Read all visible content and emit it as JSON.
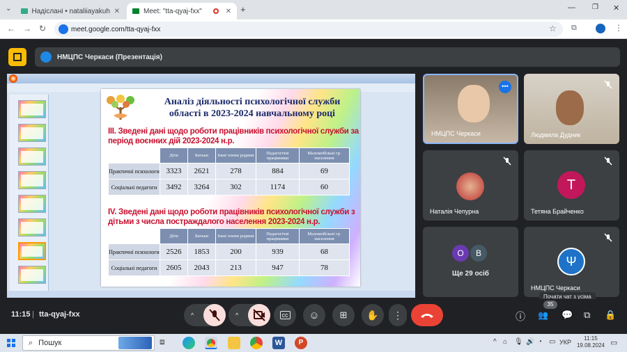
{
  "browser": {
    "tabs": [
      {
        "label": "Надіслані • nataliiayakuhina@",
        "active": false
      },
      {
        "label": "Meet: \"tta-qyaj-fxx\"",
        "active": true
      }
    ],
    "url": "meet.google.com/tta-qyaj-fxx"
  },
  "meet": {
    "presenting_label": "НМЦПС Черкаси (Презентація)",
    "time": "11:15",
    "meeting_code": "tta-qyaj-fxx",
    "participant_count": "35",
    "tooltip": "Почати чат з усіма",
    "others_label": "Ще 29 осіб",
    "participants": [
      {
        "name": "НМЦПС Черкаси"
      },
      {
        "name": "Людмила Дудник"
      },
      {
        "name": "Наталія Чепурна"
      },
      {
        "name": "Тетяна Брайченко",
        "initial": "Т",
        "color": "#c2185b"
      },
      {
        "name": "Ще 29 осіб",
        "initials": [
          "О",
          "В"
        ]
      },
      {
        "name": "НМЦПС Черкаси"
      }
    ]
  },
  "slide": {
    "title_line1": "Аналіз діяльності психологічної служби",
    "title_line2": "області  в 2023-2024 навчальному році",
    "section3": "ІІІ. Зведені дані щодо роботи працівників психологічної служби за період воєнних дій 2023-2024 н.р.",
    "section4": "IV. Зведені дані щодо роботи працівників психологічної служби з дітьми з числа постраждалого населення 2023-2024 н.р.",
    "headers3": [
      "Діти",
      "Батьки",
      "Інші члени родини",
      "Педагогічні працівники",
      "Маломобільні гр. населення"
    ],
    "rows3": [
      {
        "label": "Практичні психологи",
        "values": [
          "3323",
          "2621",
          "278",
          "884",
          "69"
        ]
      },
      {
        "label": "Соціальні педагоги",
        "values": [
          "3492",
          "3264",
          "302",
          "1174",
          "60"
        ]
      }
    ],
    "headers4": [
      "Діти",
      "Батьки",
      "Інші члени родини",
      "Педагогічні працівники",
      "Маломобільні гр. населення"
    ],
    "rows4": [
      {
        "label": "Практичні психологи",
        "values": [
          "2526",
          "1853",
          "200",
          "939",
          "68"
        ]
      },
      {
        "label": "Соціальні педагоги",
        "values": [
          "2605",
          "2043",
          "213",
          "947",
          "78"
        ]
      }
    ]
  },
  "taskbar": {
    "search": "Пошук",
    "lang": "УКР",
    "time": "11:15",
    "date": "19.08.2024"
  }
}
